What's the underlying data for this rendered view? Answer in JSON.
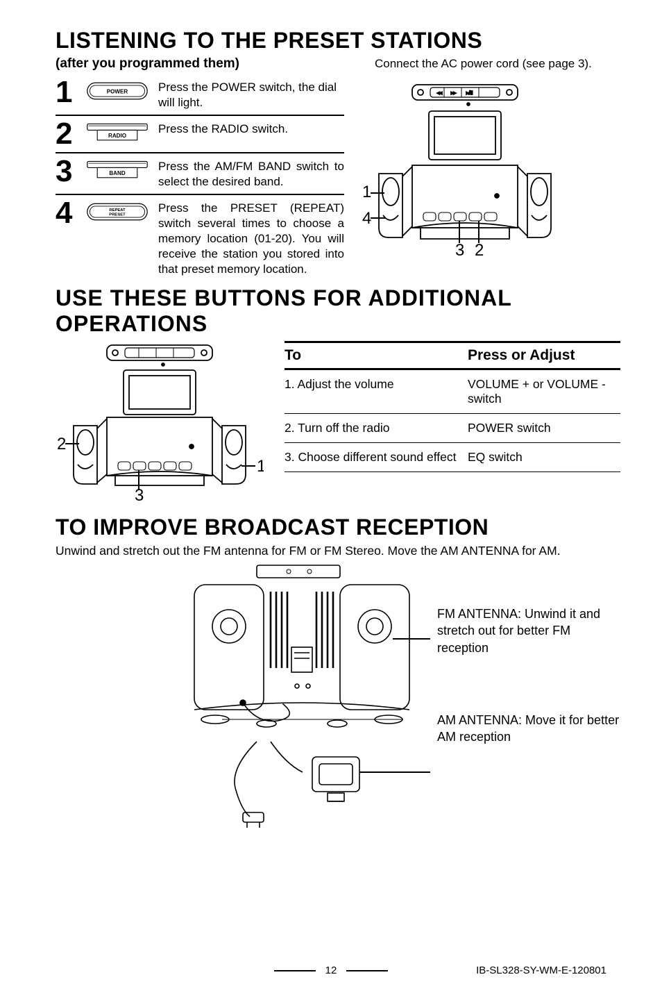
{
  "section1": {
    "title": "LISTENING TO THE PRESET STATIONS",
    "subtitle": "(after you programmed them)",
    "right_text1": "Connect the AC power cord (see page 3).",
    "steps": [
      {
        "n": "1",
        "btn": "POWER",
        "shape": "lozenge",
        "text": "Press the POWER switch, the dial will light."
      },
      {
        "n": "2",
        "btn": "RADIO",
        "shape": "tab",
        "text": "Press the RADIO switch."
      },
      {
        "n": "3",
        "btn": "BAND",
        "shape": "tab",
        "text": "Press the AM/FM BAND switch to select the desired band."
      },
      {
        "n": "4",
        "btn": "REPEAT\nPRESET",
        "shape": "lozenge",
        "text": "Press the PRESET (REPEAT) switch several times to choose a memory location (01-20). You will receive the station you stored into that preset memory location."
      }
    ],
    "diagram_labels": {
      "a": "1",
      "b": "4",
      "c": "3",
      "d": "2"
    }
  },
  "section2": {
    "title": "USE THESE BUTTONS FOR ADDITIONAL OPERATIONS",
    "diagram_labels": {
      "a": "2",
      "b": "1",
      "c": "3"
    },
    "table": {
      "head": {
        "c1": "To",
        "c2": "Press or Adjust"
      },
      "rows": [
        {
          "c1": "1. Adjust the volume",
          "c2": "VOLUME + or VOLUME - switch"
        },
        {
          "c1": "2. Turn off the radio",
          "c2": "POWER switch"
        },
        {
          "c1": "3. Choose different sound effect",
          "c2": "EQ switch"
        }
      ]
    }
  },
  "section3": {
    "title": "TO IMPROVE BROADCAST RECEPTION",
    "intro": "Unwind and stretch out the FM antenna for FM or FM Stereo.  Move the AM ANTENNA for AM.",
    "fm": "FM ANTENNA: Unwind it and stretch out for better FM reception",
    "am": "AM ANTENNA: Move it for better AM reception"
  },
  "footer": {
    "page": "12",
    "code": "IB-SL328-SY-WM-E-120801"
  }
}
